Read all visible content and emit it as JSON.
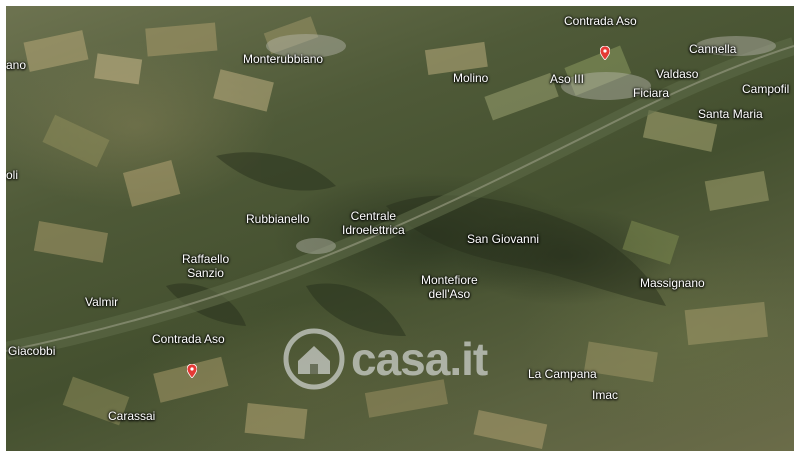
{
  "map": {
    "labels": [
      {
        "id": "contrada-aso-north",
        "text": "Contrada Aso"
      },
      {
        "id": "cannella",
        "text": "Cannella"
      },
      {
        "id": "monterubbiano",
        "text": "Monterubbiano"
      },
      {
        "id": "ano",
        "text": "ano"
      },
      {
        "id": "molino",
        "text": "Molino"
      },
      {
        "id": "aso-iii",
        "text": "Aso III"
      },
      {
        "id": "valdaso",
        "text": "Valdaso"
      },
      {
        "id": "ficiara",
        "text": "Ficiara"
      },
      {
        "id": "campofilone",
        "text": "Campofil"
      },
      {
        "id": "santa-maria",
        "text": "Santa Maria"
      },
      {
        "id": "oli",
        "text": "oli"
      },
      {
        "id": "rubbianello",
        "text": "Rubbianello"
      },
      {
        "id": "centrale-idroelettrica",
        "text": "Centrale\nIdroelettrica"
      },
      {
        "id": "san-giovanni",
        "text": "San Giovanni"
      },
      {
        "id": "raffaello-sanzio",
        "text": "Raffaello\nSanzio"
      },
      {
        "id": "montefiore",
        "text": "Montefiore\ndell'Aso"
      },
      {
        "id": "massignano",
        "text": "Massignano"
      },
      {
        "id": "valmir",
        "text": "Valmir"
      },
      {
        "id": "contrada-aso-south",
        "text": "Contrada Aso"
      },
      {
        "id": "giacobbi",
        "text": "Giacobbi"
      },
      {
        "id": "la-campana",
        "text": "La Campana"
      },
      {
        "id": "imac",
        "text": "Imac"
      },
      {
        "id": "carassai",
        "text": "Carassai"
      }
    ],
    "markers": [
      {
        "id": "marker-north",
        "color": "#e53935"
      },
      {
        "id": "marker-south",
        "color": "#e53935"
      }
    ]
  },
  "watermark": {
    "text": "casa.it",
    "icon": "house-icon"
  }
}
